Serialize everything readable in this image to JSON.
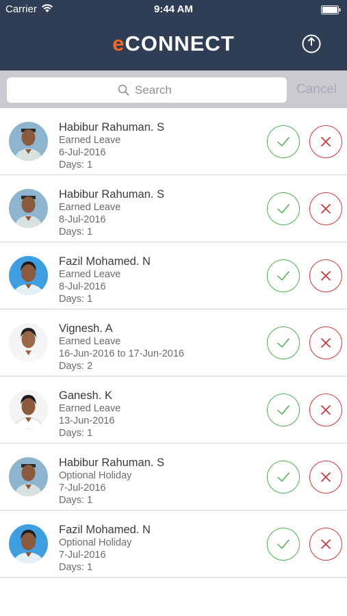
{
  "status_bar": {
    "carrier": "Carrier",
    "time": "9:44 AM",
    "wifi_icon": "wifi-icon",
    "battery_icon": "battery-icon"
  },
  "header": {
    "logo_e": "e",
    "logo_rest": "CONNECT",
    "logout_icon": "power-icon"
  },
  "search": {
    "placeholder": "Search",
    "cancel_label": "Cancel"
  },
  "colors": {
    "header_bg": "#2f3e55",
    "logo_accent": "#f26a22",
    "approve": "#4caf50",
    "reject": "#d0353a"
  },
  "leave_requests": [
    {
      "name": "Habibur Rahuman. S",
      "type": "Earned Leave",
      "date": "6-Jul-2016",
      "days": "Days: 1"
    },
    {
      "name": "Habibur Rahuman. S",
      "type": "Earned Leave",
      "date": "8-Jul-2016",
      "days": "Days: 1"
    },
    {
      "name": "Fazil Mohamed. N",
      "type": "Earned Leave",
      "date": "8-Jul-2016",
      "days": "Days: 1"
    },
    {
      "name": "Vignesh. A",
      "type": "Earned Leave",
      "date": "16-Jun-2016 to 17-Jun-2016",
      "days": "Days: 2"
    },
    {
      "name": "Ganesh. K",
      "type": "Earned Leave",
      "date": "13-Jun-2016",
      "days": "Days: 1"
    },
    {
      "name": "Habibur Rahuman. S",
      "type": "Optional Holiday",
      "date": "7-Jul-2016",
      "days": "Days: 1"
    },
    {
      "name": "Fazil Mohamed. N",
      "type": "Optional Holiday",
      "date": "7-Jul-2016",
      "days": "Days: 1"
    }
  ]
}
